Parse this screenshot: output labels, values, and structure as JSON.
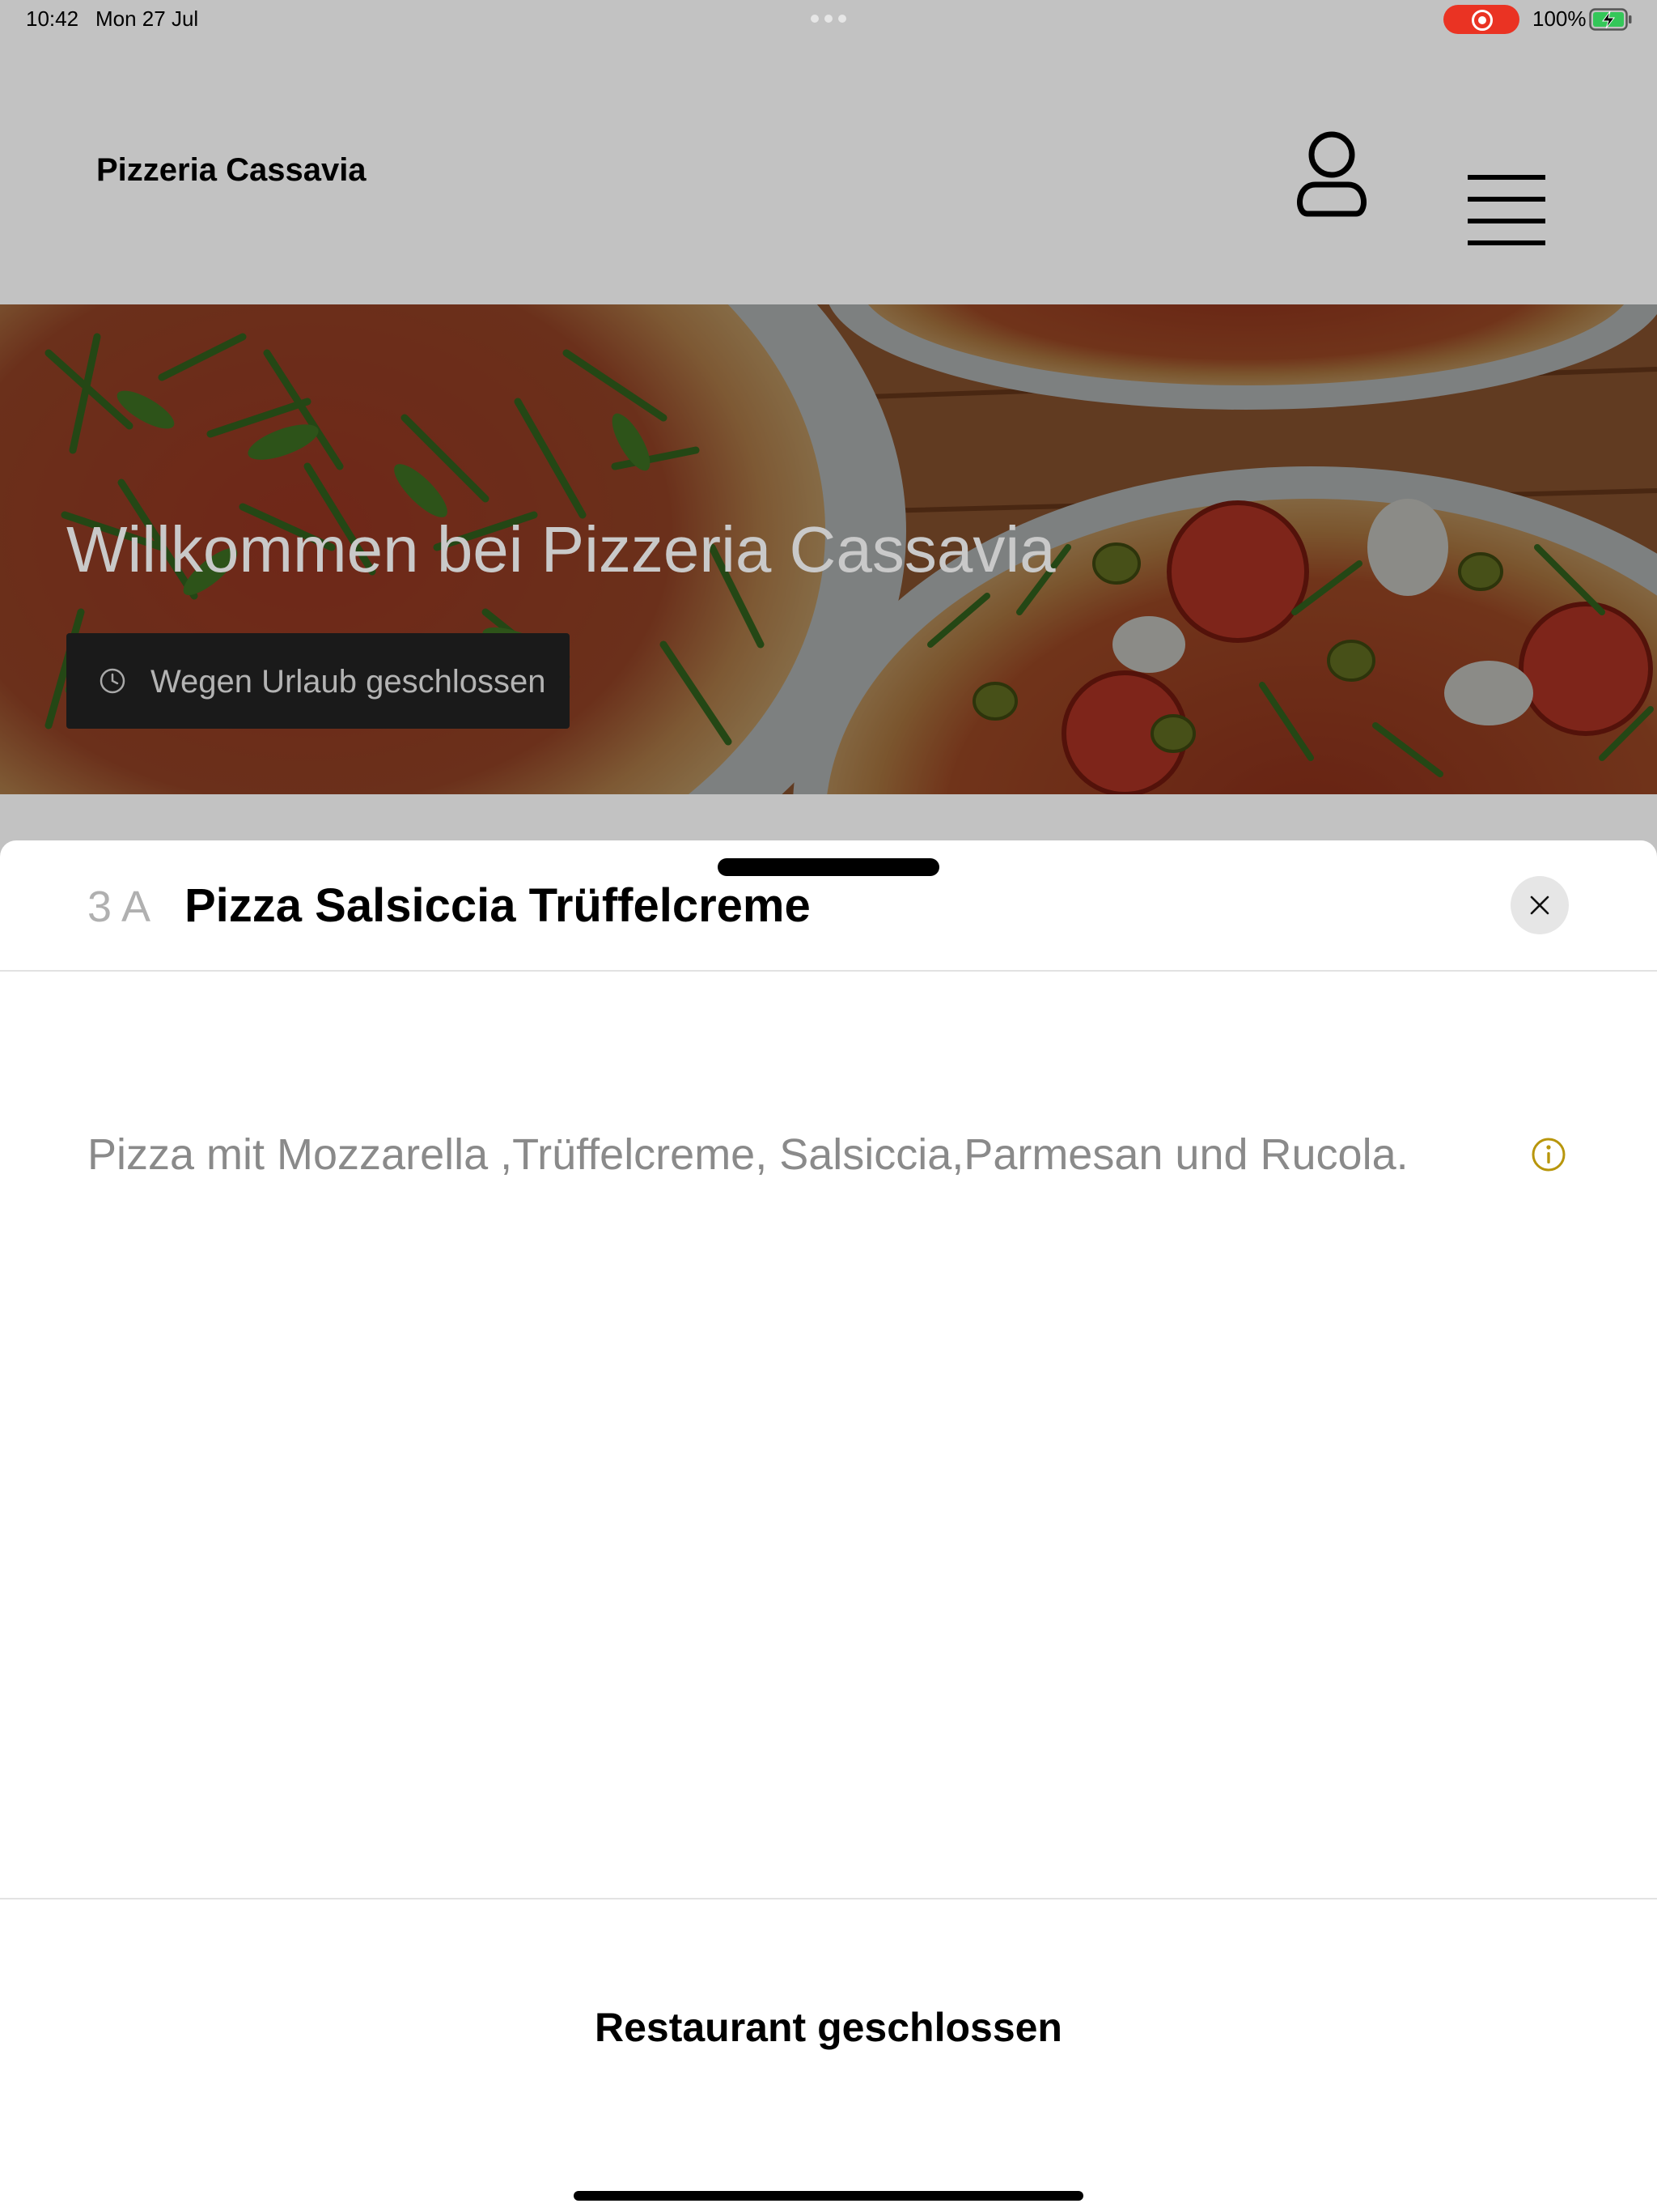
{
  "status_bar": {
    "time": "10:42",
    "date": "Mon 27 Jul",
    "battery_percent": "100%",
    "battery_level": 1.0,
    "charging": true,
    "screen_recording": true,
    "recording_color": "#ea3323"
  },
  "header": {
    "title": "Pizzeria Cassavia",
    "account_icon": "person-icon",
    "menu_icon": "hamburger-icon"
  },
  "hero": {
    "title": "Willkommen bei Pizzeria Cassavia",
    "hours_status": "Wegen Urlaub geschlossen",
    "hours_icon": "clock-icon"
  },
  "item_sheet": {
    "code": "3 A",
    "name": "Pizza Salsiccia Trüffelcreme",
    "description": "Pizza mit Mozzarella ,Trüffelcreme, Salsiccia,Parmesan und Rucola.",
    "info_icon": "info-icon",
    "info_icon_color": "#b8960c",
    "close_icon": "close-icon",
    "status_label": "Restaurant geschlossen"
  }
}
